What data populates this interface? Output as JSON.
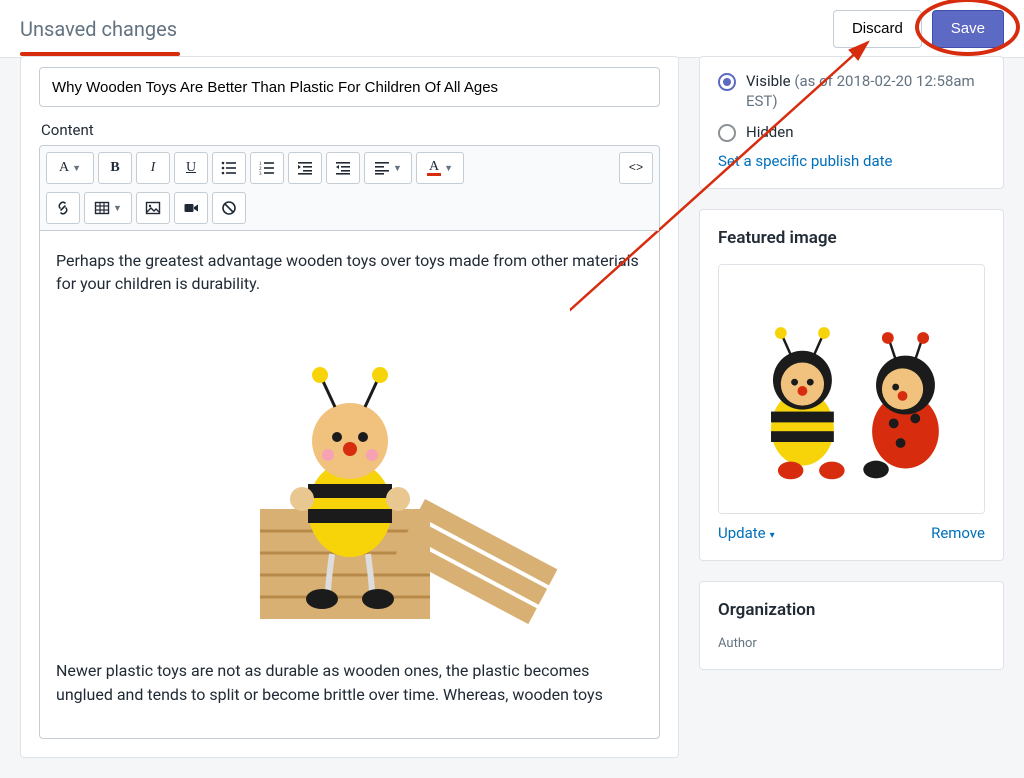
{
  "topbar": {
    "status": "Unsaved changes",
    "discard": "Discard",
    "save": "Save"
  },
  "main": {
    "title_value": "Why Wooden Toys Are Better Than Plastic For Children Of All Ages",
    "content_label": "Content",
    "para1": "Perhaps the greatest advantage wooden toys over toys made from other materials for your children is durability.",
    "para2": "Newer plastic toys are not as durable as wooden ones, the plastic becomes unglued and tends to split or become brittle over time.  Whereas, wooden toys",
    "toolbar": {
      "font": "A",
      "bold": "B",
      "italic": "I",
      "underline": "U",
      "color": "A",
      "html": "<>"
    }
  },
  "visibility": {
    "visible_label": "Visible",
    "visible_suffix": " (as of 2018-02-20 12:58am EST)",
    "hidden_label": "Hidden",
    "publish_link": "Set a specific publish date"
  },
  "featured": {
    "title": "Featured image",
    "update": "Update",
    "remove": "Remove"
  },
  "organization": {
    "title": "Organization",
    "author_label": "Author"
  }
}
